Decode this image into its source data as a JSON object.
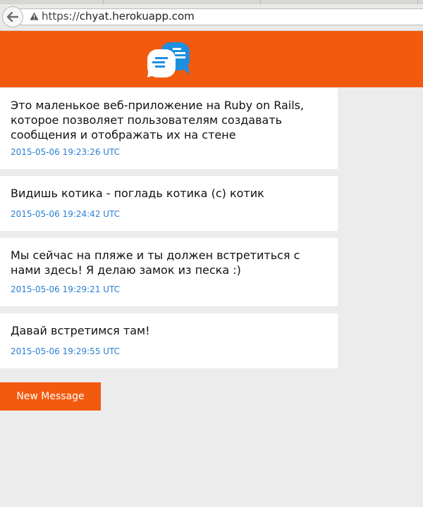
{
  "browser": {
    "url_scheme": "https://",
    "url_host": "chyat.herokuapp.com"
  },
  "header": {
    "logo_icon": "chat-bubbles-icon",
    "brand_color": "#f25a0f"
  },
  "messages": [
    {
      "text": "Это маленькое веб-приложение на Ruby on Rails, которое позволяет пользователям создавать сообщения и отображать их на стене",
      "timestamp": "2015-05-06 19:23:26 UTC"
    },
    {
      "text": "Видишь котика - погладь котика (с) котик",
      "timestamp": "2015-05-06 19:24:42 UTC"
    },
    {
      "text": "Мы сейчас на пляже и ты должен встретиться с нами здесь! Я делаю замок из песка :)",
      "timestamp": "2015-05-06 19:29:21 UTC"
    },
    {
      "text": "Давай встретимся там!",
      "timestamp": "2015-05-06 19:29:55 UTC"
    }
  ],
  "actions": {
    "new_message_label": "New Message"
  },
  "colors": {
    "accent": "#f25a0f",
    "timestamp": "#2a7fd3",
    "page_bg": "#ececec"
  }
}
